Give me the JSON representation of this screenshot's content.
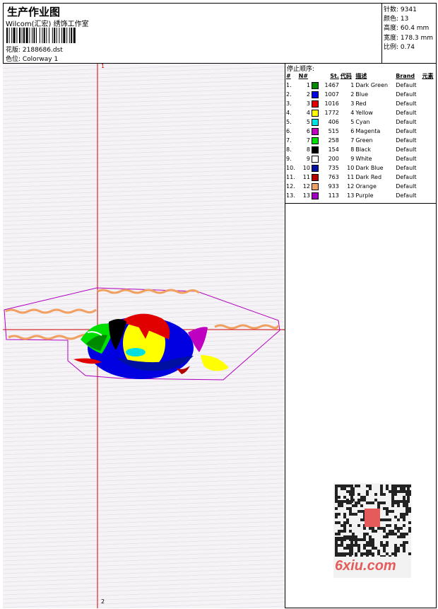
{
  "header": {
    "title": "生产作业图",
    "company": "Wilcom(汇宏) 绣饰工作室",
    "design_label": "花版: 2188686.dst",
    "colorway_label": "色位: Colorway 1"
  },
  "stats": {
    "stitches": "针数: 9341",
    "colors": "颜色: 13",
    "height": "高度: 60.4 mm",
    "width": "宽度: 178.3 mm",
    "scale": "比例: 0.74"
  },
  "canvas": {
    "axis_top_label": "1",
    "axis_bottom_label": "2"
  },
  "stop_sequence": {
    "title": "停止顺序:",
    "headers": [
      "#",
      "N#",
      "St.",
      "代码",
      "描述",
      "Brand",
      "元素"
    ],
    "rows": [
      {
        "idx": "1.",
        "n": "1",
        "st": "1467",
        "code": "1",
        "desc": "Dark Green",
        "brand": "Default",
        "color": "#008a00"
      },
      {
        "idx": "2.",
        "n": "2",
        "st": "1007",
        "code": "2",
        "desc": "Blue",
        "brand": "Default",
        "color": "#0000e0"
      },
      {
        "idx": "3.",
        "n": "3",
        "st": "1016",
        "code": "3",
        "desc": "Red",
        "brand": "Default",
        "color": "#e00000"
      },
      {
        "idx": "4.",
        "n": "4",
        "st": "1772",
        "code": "4",
        "desc": "Yellow",
        "brand": "Default",
        "color": "#ffff00"
      },
      {
        "idx": "5.",
        "n": "5",
        "st": "406",
        "code": "5",
        "desc": "Cyan",
        "brand": "Default",
        "color": "#00e0e0"
      },
      {
        "idx": "6.",
        "n": "6",
        "st": "515",
        "code": "6",
        "desc": "Magenta",
        "brand": "Default",
        "color": "#c000c0"
      },
      {
        "idx": "7.",
        "n": "7",
        "st": "258",
        "code": "7",
        "desc": "Green",
        "brand": "Default",
        "color": "#00e000"
      },
      {
        "idx": "8.",
        "n": "8",
        "st": "154",
        "code": "8",
        "desc": "Black",
        "brand": "Default",
        "color": "#000000"
      },
      {
        "idx": "9.",
        "n": "9",
        "st": "200",
        "code": "9",
        "desc": "White",
        "brand": "Default",
        "color": "#ffffff"
      },
      {
        "idx": "10.",
        "n": "10",
        "st": "735",
        "code": "10",
        "desc": "Dark Blue",
        "brand": "Default",
        "color": "#0010a0"
      },
      {
        "idx": "11.",
        "n": "11",
        "st": "763",
        "code": "11",
        "desc": "Dark Red",
        "brand": "Default",
        "color": "#b00000"
      },
      {
        "idx": "12.",
        "n": "12",
        "st": "933",
        "code": "12",
        "desc": "Orange",
        "brand": "Default",
        "color": "#f0a060"
      },
      {
        "idx": "13.",
        "n": "13",
        "st": "113",
        "code": "13",
        "desc": "Purple",
        "brand": "Default",
        "color": "#a000c0"
      }
    ]
  },
  "watermark": {
    "site": "6xiu.com"
  }
}
